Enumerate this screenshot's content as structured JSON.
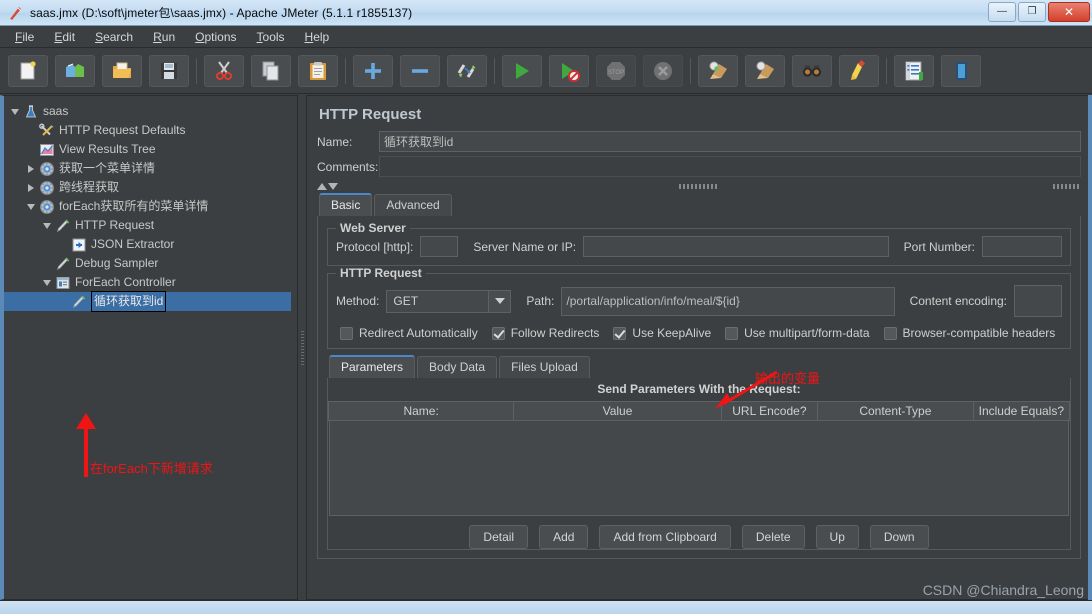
{
  "window": {
    "title": "saas.jmx (D:\\soft\\jmeter包\\saas.jmx) - Apache JMeter (5.1.1 r1855137)",
    "icon": "jmeter-feather-icon",
    "minimize_label": "—",
    "maximize_label": "❐",
    "close_label": "✕"
  },
  "menubar": {
    "items": [
      {
        "label": "File",
        "mnemonic": "F"
      },
      {
        "label": "Edit",
        "mnemonic": "E"
      },
      {
        "label": "Search",
        "mnemonic": "S"
      },
      {
        "label": "Run",
        "mnemonic": "R"
      },
      {
        "label": "Options",
        "mnemonic": "O"
      },
      {
        "label": "Tools",
        "mnemonic": "T"
      },
      {
        "label": "Help",
        "mnemonic": "H"
      }
    ]
  },
  "toolbar": {
    "buttons": [
      {
        "name": "new-icon",
        "tip": "New",
        "enabled": true
      },
      {
        "name": "templates-icon",
        "tip": "Templates",
        "enabled": true
      },
      {
        "name": "open-icon",
        "tip": "Open",
        "enabled": true
      },
      {
        "name": "save-icon",
        "tip": "Save",
        "enabled": true
      },
      {
        "name": "cut-icon",
        "tip": "Cut",
        "enabled": true
      },
      {
        "name": "copy-icon",
        "tip": "Copy",
        "enabled": true
      },
      {
        "name": "paste-icon",
        "tip": "Paste",
        "enabled": true
      },
      {
        "name": "expand-all-icon",
        "tip": "Expand All",
        "enabled": true
      },
      {
        "name": "collapse-all-icon",
        "tip": "Collapse All",
        "enabled": true
      },
      {
        "name": "toggle-icon",
        "tip": "Toggle",
        "enabled": true
      },
      {
        "name": "start-icon",
        "tip": "Start",
        "enabled": true
      },
      {
        "name": "start-no-timers-icon",
        "tip": "Start no pauses",
        "enabled": true
      },
      {
        "name": "stop-icon",
        "tip": "Stop",
        "enabled": false
      },
      {
        "name": "shutdown-icon",
        "tip": "Shutdown",
        "enabled": false
      },
      {
        "name": "clear-icon",
        "tip": "Clear",
        "enabled": true
      },
      {
        "name": "clear-all-icon",
        "tip": "Clear All",
        "enabled": true
      },
      {
        "name": "search-icon",
        "tip": "Search",
        "enabled": true
      },
      {
        "name": "reset-search-icon",
        "tip": "Reset Search",
        "enabled": true
      },
      {
        "name": "function-helper-icon",
        "tip": "Function Helper Dialog",
        "enabled": true
      },
      {
        "name": "help-icon",
        "tip": "Help",
        "enabled": true
      }
    ]
  },
  "tree": {
    "nodes": [
      {
        "label": "saas",
        "indent": 0,
        "twist": "open",
        "icon": "test-plan-icon",
        "selected": false
      },
      {
        "label": "HTTP Request Defaults",
        "indent": 1,
        "twist": "none",
        "icon": "config-element-icon",
        "selected": false
      },
      {
        "label": "View Results Tree",
        "indent": 1,
        "twist": "none",
        "icon": "listener-icon",
        "selected": false
      },
      {
        "label": "获取一个菜单详情",
        "indent": 1,
        "twist": "closed",
        "icon": "thread-group-icon",
        "selected": false
      },
      {
        "label": "跨线程获取",
        "indent": 1,
        "twist": "closed",
        "icon": "thread-group-icon",
        "selected": false
      },
      {
        "label": "forEach获取所有的菜单详情",
        "indent": 1,
        "twist": "open",
        "icon": "thread-group-icon",
        "selected": false
      },
      {
        "label": "HTTP Request",
        "indent": 2,
        "twist": "open",
        "icon": "http-sampler-icon",
        "selected": false
      },
      {
        "label": "JSON Extractor",
        "indent": 3,
        "twist": "none",
        "icon": "post-processor-icon",
        "selected": false
      },
      {
        "label": "Debug Sampler",
        "indent": 2,
        "twist": "none",
        "icon": "http-sampler-icon",
        "selected": false
      },
      {
        "label": "ForEach Controller",
        "indent": 2,
        "twist": "open",
        "icon": "logic-controller-icon",
        "selected": false
      },
      {
        "label": "循环获取到id",
        "indent": 3,
        "twist": "none",
        "icon": "http-sampler-icon",
        "selected": true
      }
    ],
    "annotation": {
      "text": "在forEach下新增请求",
      "color": "#f01414",
      "arrow": "up-arrow-annotation"
    }
  },
  "main": {
    "title": "HTTP Request",
    "name_label": "Name:",
    "name_value": "循环获取到id",
    "comments_label": "Comments:",
    "comments_value": "",
    "tabs": [
      {
        "label": "Basic",
        "active": true
      },
      {
        "label": "Advanced",
        "active": false
      }
    ],
    "web_server": {
      "group_title": "Web Server",
      "protocol_label": "Protocol [http]:",
      "protocol_value": "",
      "server_label": "Server Name or IP:",
      "server_value": "",
      "port_label": "Port Number:",
      "port_value": ""
    },
    "http_request": {
      "group_title": "HTTP Request",
      "method_label": "Method:",
      "method_value": "GET",
      "path_label": "Path:",
      "path_value": "/portal/application/info/meal/${id}",
      "content_encoding_label": "Content encoding:",
      "content_encoding_value": "",
      "checkboxes": [
        {
          "label": "Redirect Automatically",
          "checked": false
        },
        {
          "label": "Follow Redirects",
          "checked": true
        },
        {
          "label": "Use KeepAlive",
          "checked": true
        },
        {
          "label": "Use multipart/form-data",
          "checked": false
        },
        {
          "label": "Browser-compatible headers",
          "checked": false
        }
      ],
      "annotation": {
        "text": "输出的变量",
        "color": "#f01414",
        "arrow": "diagonal-arrow-annotation"
      }
    },
    "params": {
      "tabs": [
        {
          "label": "Parameters",
          "active": true
        },
        {
          "label": "Body Data",
          "active": false
        },
        {
          "label": "Files Upload",
          "active": false
        }
      ],
      "send_header": "Send Parameters With the Request:",
      "columns": [
        "Name:",
        "Value",
        "URL Encode?",
        "Content-Type",
        "Include Equals?"
      ],
      "rows": [],
      "buttons": [
        "Detail",
        "Add",
        "Add from Clipboard",
        "Delete",
        "Up",
        "Down"
      ]
    }
  },
  "watermark": "CSDN @Chiandra_Leong"
}
